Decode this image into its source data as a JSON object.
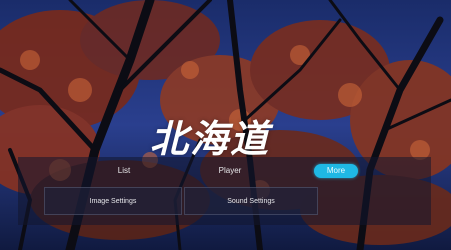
{
  "logo_text": "北海道",
  "tabs": [
    {
      "label": "List",
      "active": false
    },
    {
      "label": "Player",
      "active": false
    },
    {
      "label": "More",
      "active": true
    }
  ],
  "settings": [
    {
      "label": "Image Settings"
    },
    {
      "label": "Sound Settings"
    }
  ],
  "colors": {
    "accent": "#1fb8e4",
    "panel": "#12162d"
  }
}
